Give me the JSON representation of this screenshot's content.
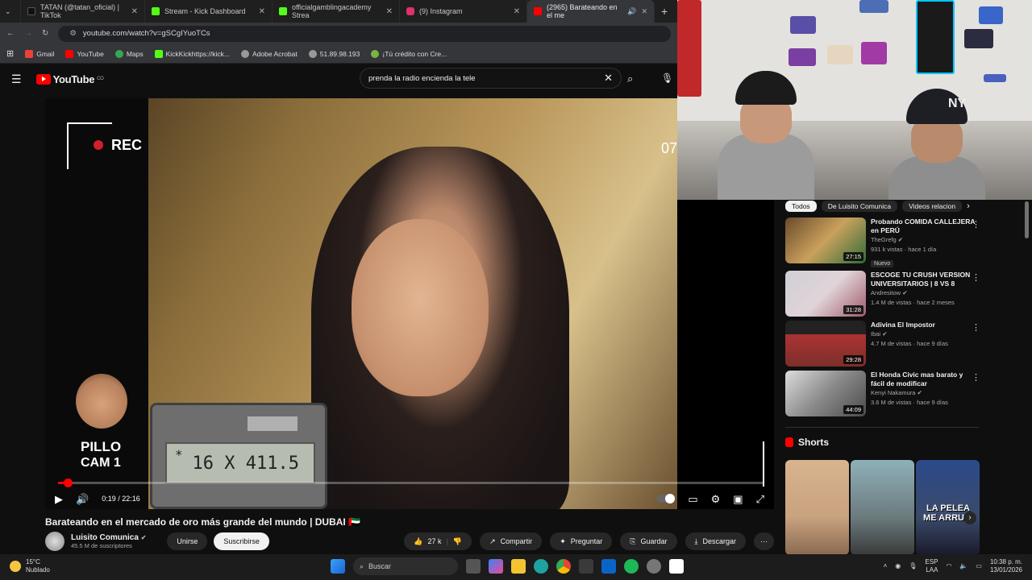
{
  "browser": {
    "tabs": [
      {
        "label": "TATAN (@tatan_oficial) | TikTok",
        "color": "#111111"
      },
      {
        "label": "Stream - Kick Dashboard",
        "color": "#53fc18"
      },
      {
        "label": "officialgamblingacademy Strea",
        "color": "#53fc18"
      },
      {
        "label": "(9) Instagram",
        "color": "#e1306c"
      },
      {
        "label": "(2965) Barateando en el me",
        "color": "#ff0000"
      }
    ],
    "url": "youtube.com/watch?v=gSCgIYuoTCs",
    "bookmarks": [
      "Gmail",
      "YouTube",
      "Maps",
      "KickKickhttps://kick...",
      "Adobe Acrobat",
      "51.89.98.193",
      "¡Tú crédito con Cre..."
    ]
  },
  "youtube": {
    "logo": "YouTube",
    "country": "CO",
    "search_value": "prenda la radio encienda la tele"
  },
  "video": {
    "rec_label": "REC",
    "rec_time": "07",
    "calc_display": "16 X 411.5",
    "calc_star": "*",
    "pillo_name": "PILLO",
    "pillo_cam": "CAM 1",
    "time": "0:19 / 22:16",
    "progress_fraction": 0.014,
    "title": "Barateando en el mercado de oro más grande del mundo | DUBAI 🇦🇪"
  },
  "channel": {
    "name": "Luisito Comunica",
    "subs": "45.5 M de suscriptores",
    "join": "Unirse",
    "subscribe": "Suscribirse",
    "likes": "27 k",
    "share": "Compartir",
    "ask": "Preguntar",
    "save": "Guardar",
    "download": "Descargar"
  },
  "chips": [
    "Todos",
    "De Luisito Comunica",
    "Videos relacion"
  ],
  "related": [
    {
      "title": "Probando COMIDA CALLEJERA en PERÚ",
      "channel": "TheGrefg",
      "meta": "931 k vistas · hace 1 día",
      "badge": "Nuevo",
      "duration": "27:15",
      "color": "#6a4a2c"
    },
    {
      "title": "ESCOGE TU CRUSH VERSION UNIVERSITARIOS | 8 VS 8",
      "channel": "Andresitow",
      "meta": "1.4 M de vistas · hace 2 meses",
      "badge": "",
      "duration": "31:28",
      "color": "#b8b6be"
    },
    {
      "title": "Adivina El Impostor",
      "channel": "Ibai",
      "meta": "4.7 M de vistas · hace 9 días",
      "badge": "",
      "duration": "29:28",
      "color": "#7d2f2a"
    },
    {
      "title": "El Honda Civic mas barato y fácil de modificar",
      "channel": "Kenyi Nakamura",
      "meta": "3.6 M de vistas · hace 9 días",
      "badge": "",
      "duration": "44:09",
      "color": "#8a8a8a"
    }
  ],
  "shorts": {
    "title": "Shorts",
    "items": [
      {
        "color": "#c9a280"
      },
      {
        "color": "#6b7b7e"
      },
      {
        "color": "#3a4a6a",
        "caption": "LA PELEA ME ARRUIN"
      }
    ]
  },
  "taskbar": {
    "temp": "15°C",
    "weather": "Nublado",
    "search": "Buscar",
    "lang": "ESP",
    "region": "LAA",
    "time": "10:38 p. m.",
    "date": "13/01/2026"
  }
}
